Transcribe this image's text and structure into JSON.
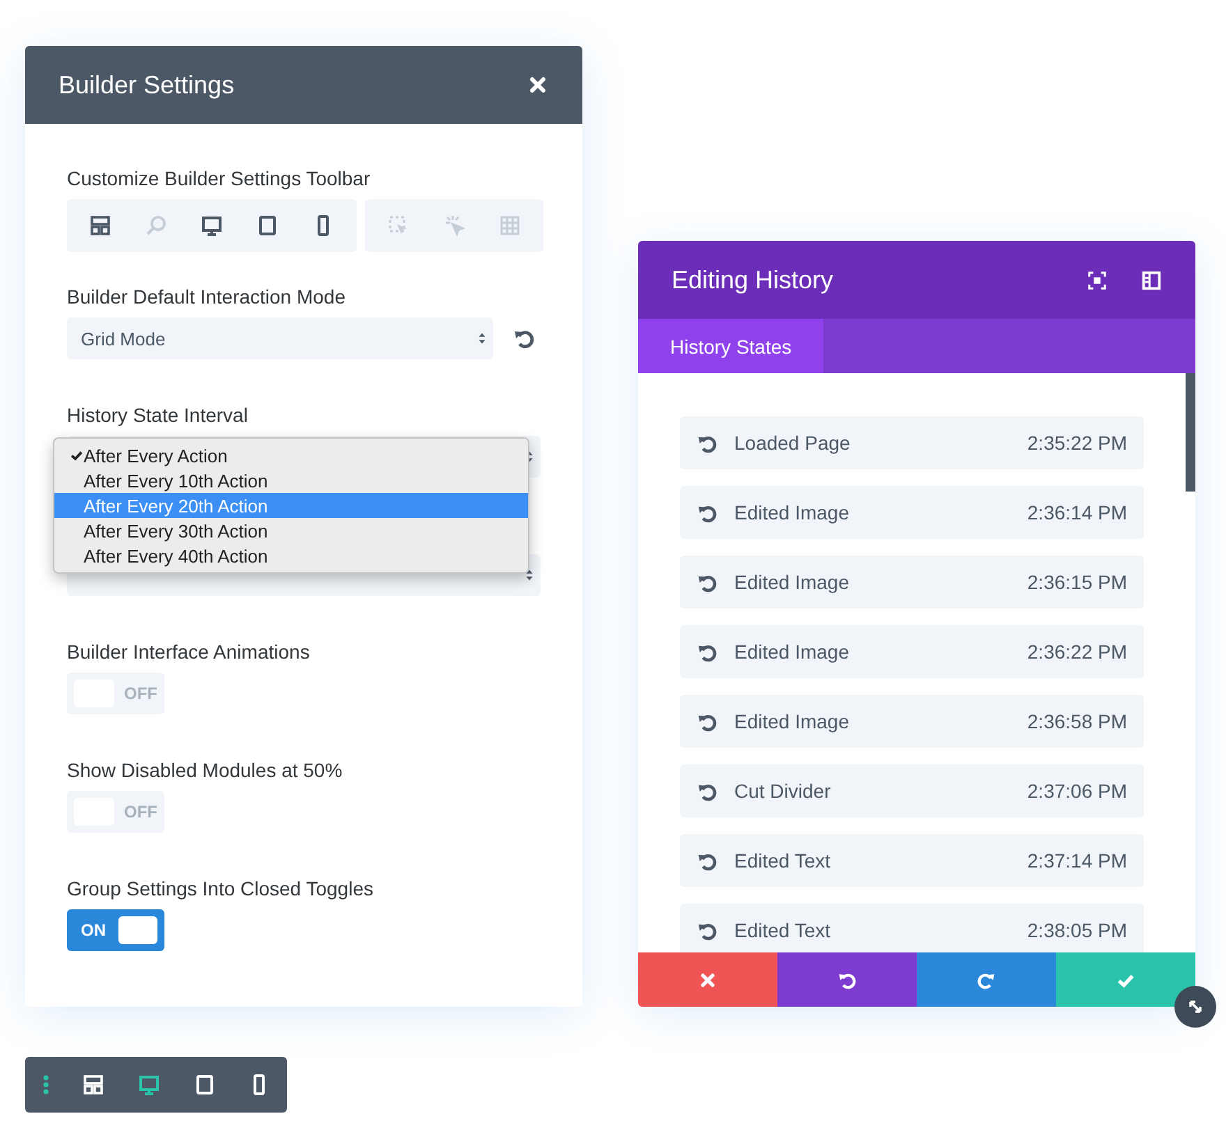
{
  "builder_settings": {
    "title": "Builder Settings",
    "close": {
      "kind": "close"
    },
    "sections": [
      {
        "kind": "toolbar",
        "label": "Customize Builder Settings Toolbar",
        "groups": [
          [
            {
              "kind": "layout",
              "disabled": false
            },
            {
              "kind": "zoom",
              "disabled": true
            },
            {
              "kind": "desktop",
              "disabled": false
            },
            {
              "kind": "tablet",
              "disabled": false
            },
            {
              "kind": "phone",
              "disabled": false
            }
          ],
          [
            {
              "kind": "hover-select",
              "disabled": true
            },
            {
              "kind": "click",
              "disabled": true
            },
            {
              "kind": "grid",
              "disabled": true
            }
          ]
        ]
      },
      {
        "kind": "select",
        "label": "Builder Default Interaction Mode",
        "value": "Grid Mode",
        "reset": true
      },
      {
        "kind": "dropdown",
        "label": "History State Interval",
        "options": [
          {
            "label": "After Every Action",
            "checked": true,
            "highlighted": false
          },
          {
            "label": "After Every 10th Action",
            "checked": false,
            "highlighted": false
          },
          {
            "label": "After Every 20th Action",
            "checked": false,
            "highlighted": true
          },
          {
            "label": "After Every 30th Action",
            "checked": false,
            "highlighted": false
          },
          {
            "label": "After Every 40th Action",
            "checked": false,
            "highlighted": false
          }
        ]
      },
      {
        "kind": "select"
      },
      {
        "kind": "toggle",
        "label": "Builder Interface Animations",
        "on": false,
        "text": "OFF"
      },
      {
        "kind": "toggle",
        "label": "Show Disabled Modules at 50%",
        "on": false,
        "text": "OFF"
      },
      {
        "kind": "toggle",
        "label": "Group Settings Into Closed Toggles",
        "on": true,
        "text": "ON"
      }
    ]
  },
  "bottom_bar": {
    "handle": true,
    "items": [
      {
        "kind": "layout",
        "selected": false
      },
      {
        "kind": "desktop",
        "selected": true
      },
      {
        "kind": "tablet",
        "selected": false
      },
      {
        "kind": "phone",
        "selected": false
      }
    ]
  },
  "editing_history": {
    "title": "Editing History",
    "header_icons": [
      {
        "kind": "fullscreen"
      },
      {
        "kind": "sidebar"
      }
    ],
    "tabs": [
      {
        "label": "History States",
        "selected": true
      }
    ],
    "states": [
      {
        "label": "Loaded Page",
        "time": "2:35:22 PM"
      },
      {
        "label": "Edited Image",
        "time": "2:36:14 PM"
      },
      {
        "label": "Edited Image",
        "time": "2:36:15 PM"
      },
      {
        "label": "Edited Image",
        "time": "2:36:22 PM"
      },
      {
        "label": "Edited Image",
        "time": "2:36:58 PM"
      },
      {
        "label": "Cut Divider",
        "time": "2:37:06 PM"
      },
      {
        "label": "Edited Text",
        "time": "2:37:14 PM"
      },
      {
        "label": "Edited Text",
        "time": "2:38:05 PM"
      }
    ],
    "actions": [
      {
        "kind": "cancel"
      },
      {
        "kind": "undo"
      },
      {
        "kind": "redo"
      },
      {
        "kind": "save"
      }
    ]
  }
}
